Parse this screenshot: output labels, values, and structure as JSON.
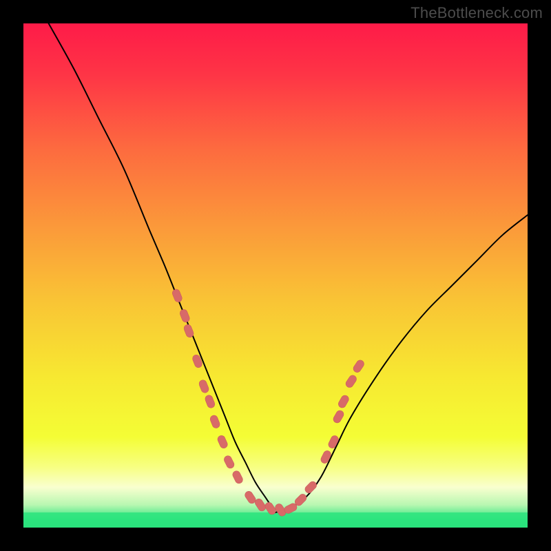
{
  "watermark": "TheBottleneck.com",
  "colors": {
    "black": "#000000",
    "curve": "#000000",
    "marker_fill": "#d86a68",
    "marker_stroke": "#c85a58",
    "green_band": "#2be47e"
  },
  "gradient_stops": [
    {
      "offset": 0.0,
      "color": "#fe1b48"
    },
    {
      "offset": 0.1,
      "color": "#fe3446"
    },
    {
      "offset": 0.25,
      "color": "#fd6b3f"
    },
    {
      "offset": 0.4,
      "color": "#fb983a"
    },
    {
      "offset": 0.55,
      "color": "#f9c435"
    },
    {
      "offset": 0.7,
      "color": "#f7e831"
    },
    {
      "offset": 0.82,
      "color": "#f4fd35"
    },
    {
      "offset": 0.88,
      "color": "#f7ff82"
    },
    {
      "offset": 0.92,
      "color": "#f9ffcf"
    },
    {
      "offset": 0.955,
      "color": "#b8f7b1"
    },
    {
      "offset": 0.985,
      "color": "#2be47e"
    },
    {
      "offset": 1.0,
      "color": "#23d374"
    }
  ],
  "chart_data": {
    "type": "line",
    "title": "",
    "xlabel": "",
    "ylabel": "",
    "xlim": [
      0,
      100
    ],
    "ylim": [
      0,
      100
    ],
    "series": [
      {
        "name": "left-branch",
        "x": [
          5,
          10,
          15,
          20,
          25,
          28,
          30,
          32,
          34,
          36,
          38,
          40,
          42,
          44,
          46,
          48,
          50
        ],
        "y": [
          100,
          91,
          81,
          71,
          59,
          52,
          47,
          42,
          37,
          32,
          27,
          22,
          17,
          13,
          9,
          6,
          3
        ]
      },
      {
        "name": "right-branch",
        "x": [
          50,
          53,
          56,
          59,
          62,
          65,
          70,
          75,
          80,
          85,
          90,
          95,
          100
        ],
        "y": [
          3,
          4,
          6,
          10,
          16,
          22,
          30,
          37,
          43,
          48,
          53,
          58,
          62
        ]
      }
    ],
    "markers": [
      {
        "x": 30.5,
        "y": 46
      },
      {
        "x": 32,
        "y": 42
      },
      {
        "x": 32.8,
        "y": 39
      },
      {
        "x": 34.5,
        "y": 33
      },
      {
        "x": 35.8,
        "y": 28
      },
      {
        "x": 37,
        "y": 25
      },
      {
        "x": 38,
        "y": 21
      },
      {
        "x": 39.5,
        "y": 17
      },
      {
        "x": 40.8,
        "y": 13
      },
      {
        "x": 42.5,
        "y": 10
      },
      {
        "x": 45,
        "y": 6
      },
      {
        "x": 47,
        "y": 4.5
      },
      {
        "x": 49,
        "y": 3.8
      },
      {
        "x": 51,
        "y": 3.5
      },
      {
        "x": 53,
        "y": 3.8
      },
      {
        "x": 55,
        "y": 5.5
      },
      {
        "x": 57,
        "y": 8
      },
      {
        "x": 60,
        "y": 14
      },
      {
        "x": 61.5,
        "y": 17
      },
      {
        "x": 62.5,
        "y": 22
      },
      {
        "x": 63.5,
        "y": 25
      },
      {
        "x": 65,
        "y": 29
      },
      {
        "x": 66.5,
        "y": 32
      }
    ],
    "green_band": {
      "y0": 0,
      "y1": 3
    }
  }
}
